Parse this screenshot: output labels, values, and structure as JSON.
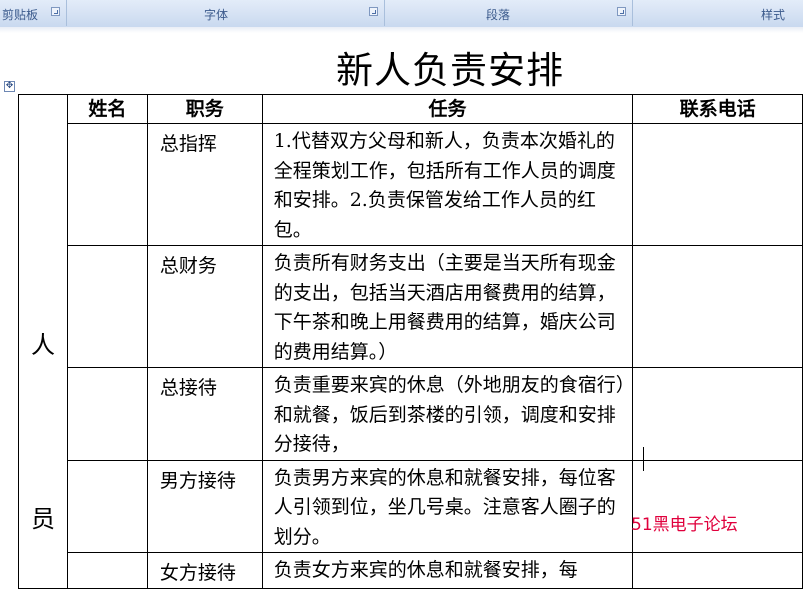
{
  "ribbon": {
    "groups": [
      {
        "label": "剪贴板"
      },
      {
        "label": "字体"
      },
      {
        "label": "段落"
      },
      {
        "label": "样式"
      }
    ]
  },
  "document": {
    "title": "新人负责安排",
    "table": {
      "side_label": [
        "人",
        "员"
      ],
      "headers": {
        "name": "姓名",
        "role": "职务",
        "task": "任务",
        "phone": "联系电话"
      },
      "rows": [
        {
          "name": "",
          "role": "总指挥",
          "task": "1.代替双方父母和新人，负责本次婚礼的全程策划工作，包括所有工作人员的调度和安排。2.负责保管发给工作人员的红包。",
          "phone": ""
        },
        {
          "name": "",
          "role": "总财务",
          "task": "负责所有财务支出（主要是当天所有现金的支出，包括当天酒店用餐费用的结算，下午茶和晚上用餐费用的结算，婚庆公司的费用结算。）",
          "phone": ""
        },
        {
          "name": "",
          "role": "总接待",
          "task": "负责重要来宾的休息（外地朋友的食宿行）和就餐，饭后到茶楼的引领，调度和安排分接待，",
          "phone": ""
        },
        {
          "name": "",
          "role": "男方接待",
          "task": "负责男方来宾的休息和就餐安排，每位客人引领到位，坐几号桌。注意客人圈子的划分。",
          "phone": ""
        },
        {
          "name": "",
          "role": "女方接待",
          "task": "负责女方来宾的休息和就餐安排，每",
          "phone": ""
        }
      ]
    }
  },
  "watermark": "51黑电子论坛"
}
